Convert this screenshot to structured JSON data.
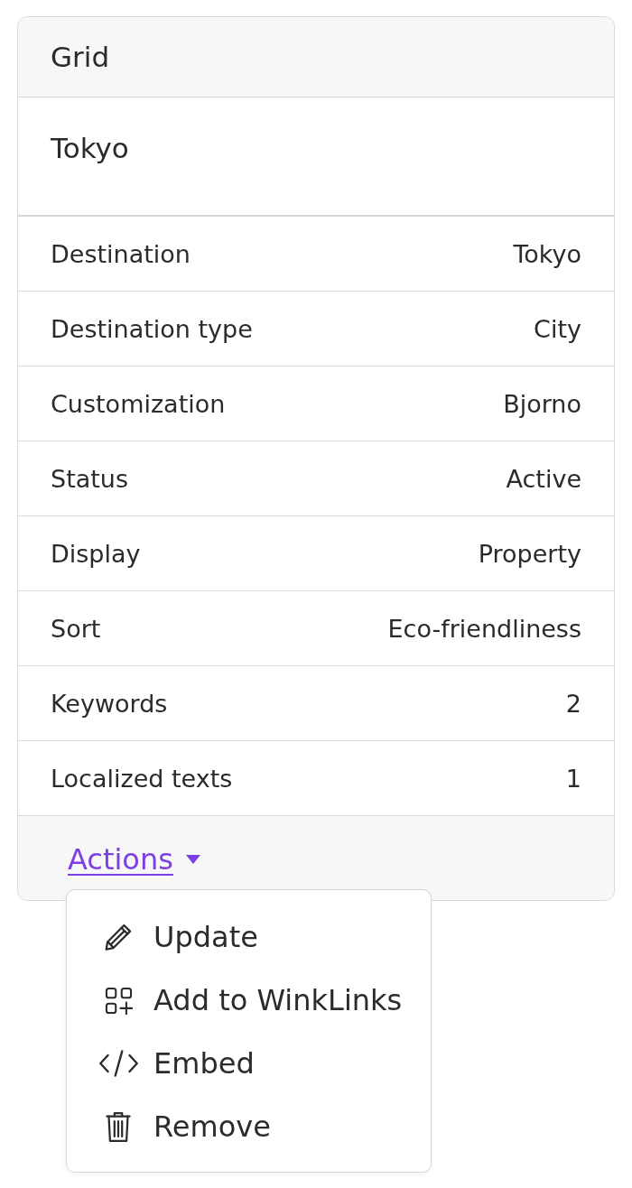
{
  "card": {
    "header": "Grid",
    "title": "Tokyo",
    "rows": [
      {
        "label": "Destination",
        "value": "Tokyo"
      },
      {
        "label": "Destination type",
        "value": "City"
      },
      {
        "label": "Customization",
        "value": "Bjorno"
      },
      {
        "label": "Status",
        "value": "Active"
      },
      {
        "label": "Display",
        "value": "Property"
      },
      {
        "label": "Sort",
        "value": "Eco-friendliness"
      },
      {
        "label": "Keywords",
        "value": "2"
      },
      {
        "label": "Localized texts",
        "value": "1"
      }
    ],
    "actions": {
      "label": "Actions",
      "expanded": true,
      "menu": [
        {
          "kind": "edit",
          "label": "Update"
        },
        {
          "kind": "add",
          "label": "Add to WinkLinks"
        },
        {
          "kind": "embed",
          "label": "Embed"
        },
        {
          "kind": "delete",
          "label": "Remove"
        }
      ]
    }
  }
}
